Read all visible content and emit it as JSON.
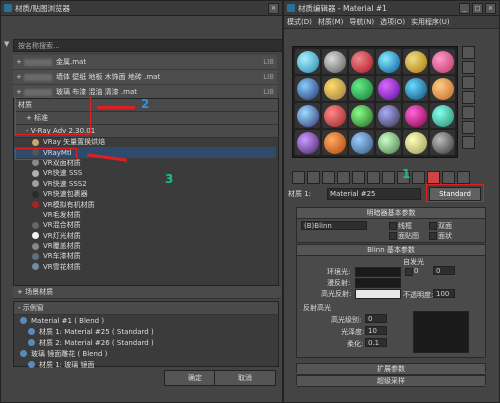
{
  "left_window": {
    "title": "材质/贴图浏览器",
    "search_placeholder": "按名称搜索...",
    "libraries": [
      {
        "name": "金属.mat",
        "tag": "LIB"
      },
      {
        "name": "墙体 壁纸 地板 木饰面 地砖 .mat",
        "tag": "LIB"
      },
      {
        "name": "玻璃 布漆 混油 清漆 .mat",
        "tag": "LIB"
      }
    ],
    "section_materials": "材质",
    "section_standard": "+ 标准",
    "section_vray": "- V-Ray Adv 2.30.01",
    "materials": [
      "VRay 矢量置换烘焙",
      "VRayMtl",
      "VR双面材质",
      "VR快速 SSS",
      "VR快速 SSS2",
      "VR快速包裹器",
      "VR模拟有机材质",
      "VR毛发材质",
      "VR混合材质",
      "VR灯光材质",
      "VR覆盖材质",
      "VR车漆材质",
      "VR雪花材质"
    ],
    "section_scene": "+ 场景材质",
    "section_sample": "- 示例窗",
    "samples": [
      "Material #1  ( Blend )",
      "材质 1: Material #25  ( Standard )",
      "材质 2: Material #26  ( Standard )",
      "玻璃 镜面雕花 ( Blend )",
      "材质 1: 玻璃 镜面 "
    ],
    "ok_label": "确定",
    "cancel_label": "取消"
  },
  "right_window": {
    "title": "材质编辑器 - Material #1",
    "menus": [
      "模式(D)",
      "材质(M)",
      "导航(N)",
      "选项(O)",
      "实用程序(U)"
    ],
    "material_label": "材质 1:",
    "material_name": "Material #25",
    "type_button": "Standard",
    "shader_rollout": "明暗器基本参数",
    "shader_value": "(B)Blinn",
    "shader_options": [
      "线框",
      "双面",
      "面贴图",
      "面状"
    ],
    "blinn_rollout": "Blinn 基本参数",
    "self_illum": "自发光",
    "color_label": "颜色",
    "color_value": "0",
    "ambient": "环境光:",
    "diffuse": "漫反射:",
    "specular": "高光反射:",
    "opacity": "不透明度:",
    "opacity_value": "100",
    "reflect_hl": "反射高光",
    "spec_level": "高光级别:",
    "spec_level_value": "0",
    "glossiness": "光泽度:",
    "glossiness_value": "10",
    "soften": "柔化:",
    "soften_value": "0.1",
    "rollout_bottom1": "扩展参数",
    "rollout_bottom2": "超级采样"
  },
  "annotations": {
    "n1": "1",
    "n2": "2",
    "n3": "3"
  },
  "colors": {
    "accent_red": "#e02020",
    "annotation_green": "#20c080",
    "selection_blue": "#2f4a6a"
  }
}
